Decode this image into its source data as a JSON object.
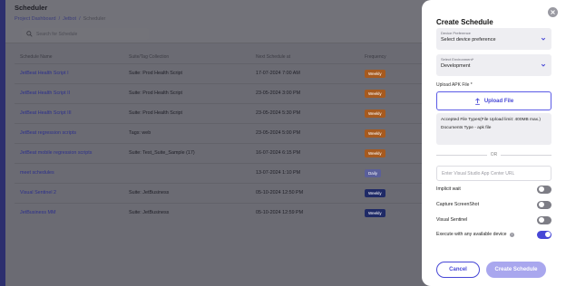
{
  "background": {
    "page_title": "Scheduler",
    "breadcrumb": [
      "Project Dashboard",
      "/",
      "Jetbot",
      "/",
      "Scheduler"
    ],
    "search_placeholder": "Search for Schedule",
    "columns": [
      "Schedule Name",
      "Suite/Tag Collection",
      "Next Schedule at",
      "Frequency"
    ],
    "rows": [
      {
        "name": "JetBeat Health Script I",
        "suite": "Suite: Prod Health Script",
        "next": "17-07-2024 7:00 AM",
        "freq": "Weekly",
        "badge": "weekly-orange"
      },
      {
        "name": "JetBeat Health Script II",
        "suite": "Suite: Prod Health Script",
        "next": "23-05-2024 3:00 PM",
        "freq": "Weekly",
        "badge": "weekly-orange"
      },
      {
        "name": "JetBeat Health Script III",
        "suite": "Suite: Prod Health Script",
        "next": "23-05-2024 5:30 PM",
        "freq": "Weekly",
        "badge": "weekly-orange"
      },
      {
        "name": "JetBeat regression scripts",
        "suite": "Tags: web",
        "next": "23-05-2024 5:00 PM",
        "freq": "Weekly",
        "badge": "weekly-orange"
      },
      {
        "name": "JetBeat mobile regression scripts",
        "suite": "Suite: Test_Suite_Sample (17)",
        "next": "16-07-2024 6:15 PM",
        "freq": "Weekly",
        "badge": "weekly-orange"
      },
      {
        "name": "meet schedules",
        "suite": "",
        "next": "13-07-2024 1:10 PM",
        "freq": "Daily",
        "badge": "daily"
      },
      {
        "name": "Visual Sentinel 2",
        "suite": "Suite: JetBusiness",
        "next": "05-10-2024 12:50 PM",
        "freq": "Weekly",
        "badge": "weekly-navy"
      },
      {
        "name": "JetBusiness MM",
        "suite": "Suite: JetBusiness",
        "next": "05-10-2024 12:59 PM",
        "freq": "Weekly",
        "badge": "weekly-navy"
      }
    ]
  },
  "drawer": {
    "title": "Create Schedule",
    "device": {
      "label": "Device Preference",
      "value": "Select device preference"
    },
    "environment": {
      "label": "Select Environment*",
      "value": "Development"
    },
    "upload_label": "Upload APK File *",
    "upload_button": "Upload File",
    "file_types": "Accepted File Types(File Upload limit: 400MB max.)",
    "doc_type": "Documents Type - apk file",
    "or_text": "OR",
    "url_placeholder": "Enter Visual Studio App Center URL",
    "toggles": [
      {
        "label": "Implicit wait",
        "on": false
      },
      {
        "label": "Capture ScreenShot",
        "on": false
      },
      {
        "label": "Visual Sentinel",
        "on": false
      },
      {
        "label": "Execute with any available device",
        "on": true,
        "info": true
      }
    ],
    "cancel_label": "Cancel",
    "create_label": "Create Schedule"
  },
  "colors": {
    "accent": "#4747d6",
    "create_disabled": "#a9a7ee",
    "badge_weekly_orange": "#a65a1f",
    "badge_daily": "#5a5f9a",
    "badge_weekly_navy": "#1f2a66"
  }
}
